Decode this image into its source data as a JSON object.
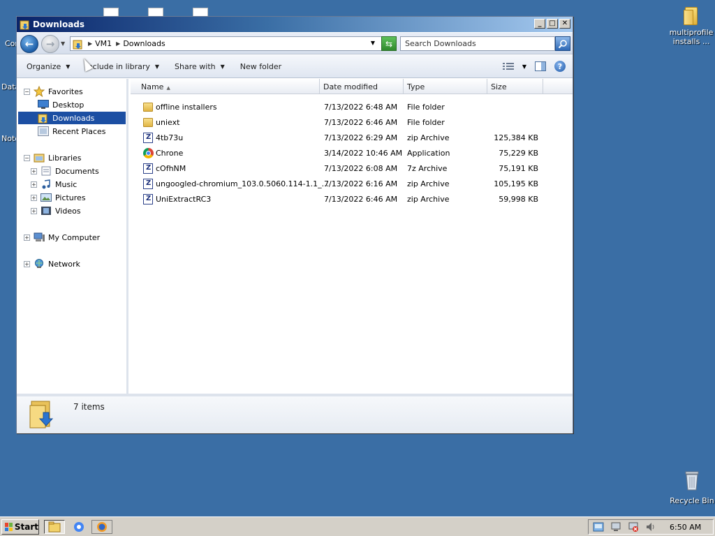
{
  "desktop": {
    "icons": [
      {
        "label": "multiprofile installs ..."
      },
      {
        "label": "Recycle Bin"
      }
    ],
    "partial_labels": [
      "Cor",
      "Data",
      "Note"
    ]
  },
  "window": {
    "title": "Downloads",
    "buttons": {
      "minimize": "_",
      "maximize": "□",
      "close": "✕"
    }
  },
  "address": {
    "crumbs": [
      "VM1",
      "Downloads"
    ],
    "search_placeholder": "Search Downloads"
  },
  "commands": {
    "organize": "Organize",
    "include": "Include in library",
    "share": "Share with",
    "new_folder": "New folder"
  },
  "nav": {
    "favorites": "Favorites",
    "desktop": "Desktop",
    "downloads": "Downloads",
    "recent": "Recent Places",
    "libraries": "Libraries",
    "documents": "Documents",
    "music": "Music",
    "pictures": "Pictures",
    "videos": "Videos",
    "computer": "My Computer",
    "network": "Network"
  },
  "columns": {
    "name": "Name",
    "date": "Date modified",
    "type": "Type",
    "size": "Size"
  },
  "files": [
    {
      "name": "offline installers",
      "date": "7/13/2022 6:48 AM",
      "type": "File folder",
      "size": "",
      "icon": "folder-icon"
    },
    {
      "name": "uniext",
      "date": "7/13/2022 6:46 AM",
      "type": "File folder",
      "size": "",
      "icon": "folder-icon"
    },
    {
      "name": "4tb73u",
      "date": "7/13/2022 6:29 AM",
      "type": "zip Archive",
      "size": "125,384 KB",
      "icon": "zip-icon"
    },
    {
      "name": "Chrone",
      "date": "3/14/2022 10:46 AM",
      "type": "Application",
      "size": "75,229 KB",
      "icon": "chrome-icon"
    },
    {
      "name": "cOfhNM",
      "date": "7/13/2022 6:08 AM",
      "type": "7z Archive",
      "size": "75,191 KB",
      "icon": "zip-icon"
    },
    {
      "name": "ungoogled-chromium_103.0.5060.114-1.1_...",
      "date": "7/13/2022 6:16 AM",
      "type": "zip Archive",
      "size": "105,195 KB",
      "icon": "zip-icon"
    },
    {
      "name": "UniExtractRC3",
      "date": "7/13/2022 6:46 AM",
      "type": "zip Archive",
      "size": "59,998 KB",
      "icon": "zip-icon"
    }
  ],
  "details": {
    "count": "7 items"
  },
  "taskbar": {
    "start": "Start",
    "clock": "6:50 AM"
  }
}
